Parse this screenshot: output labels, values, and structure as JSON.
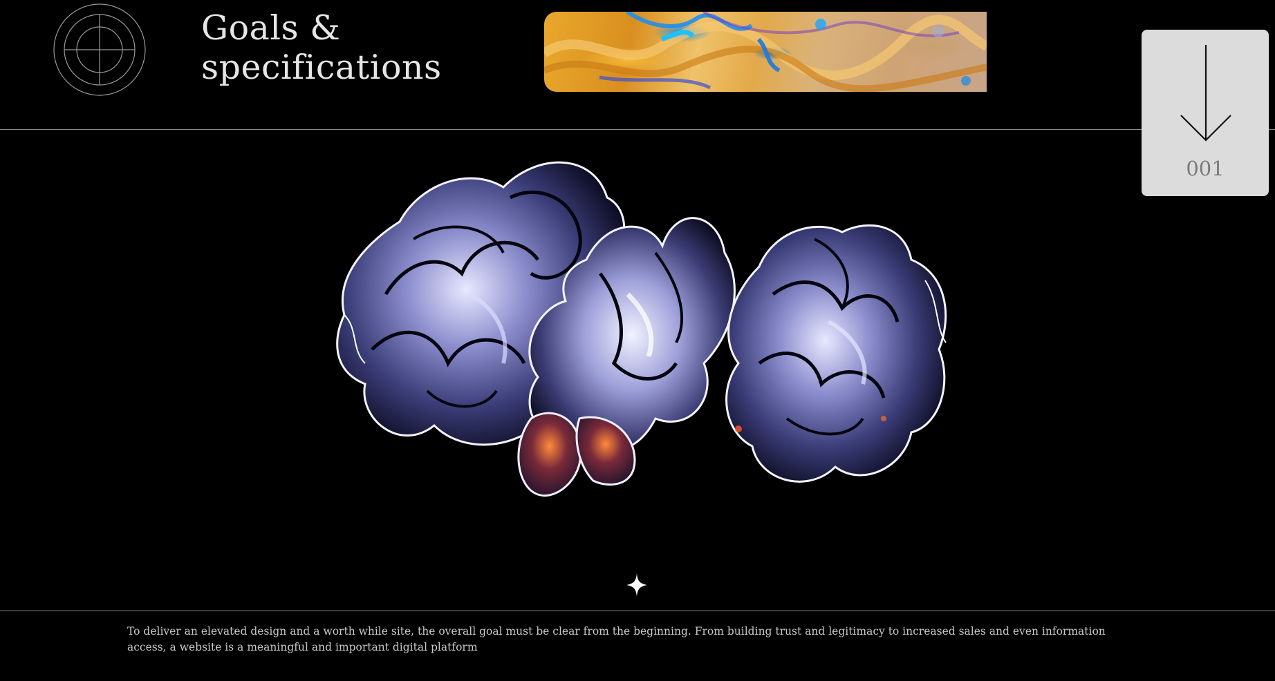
{
  "header": {
    "title_line1": "Goals &",
    "title_line2": "specifications",
    "target_icon": "crosshair-circle-icon",
    "banner_image": "liquid-marble-gold-blue-image"
  },
  "scroll_card": {
    "icon": "arrow-down-icon",
    "number": "001"
  },
  "hero": {
    "image": "chrome-flower-sculpture-image",
    "sparkle_icon": "four-point-star-icon"
  },
  "description": {
    "text": "To deliver an elevated design and a worth while site, the overall goal must be clear from the beginning. From building trust and legitimacy to increased sales and even information access, a website is a meaningful and important digital platform"
  },
  "colors": {
    "background": "#000000",
    "card": "#dcdcdc",
    "text": "#e6e6e6",
    "rule": "#8a8a8a"
  }
}
